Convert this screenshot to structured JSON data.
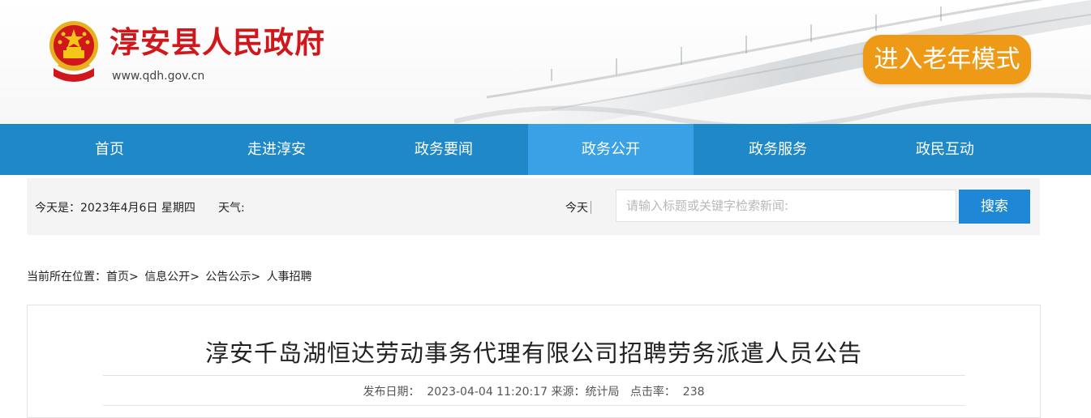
{
  "header": {
    "site_name": "淳安县人民政府",
    "site_url": "www.qdh.gov.cn",
    "elder_mode_label": "进入老年模式",
    "brand_color": "#d0171b",
    "elder_button_color": "#ef9a17"
  },
  "nav": {
    "color": "#1e88c8",
    "active_color": "#3aa1e6",
    "items": [
      {
        "label": "首页"
      },
      {
        "label": "走进淳安"
      },
      {
        "label": "政务要闻"
      },
      {
        "label": "政务公开"
      },
      {
        "label": "政务服务"
      },
      {
        "label": "政民互动"
      }
    ],
    "active_item": "政务公开"
  },
  "infobar": {
    "date_text": "今天是：2023年4月6日 星期四",
    "weather_label": "天气:",
    "today_label": "今天",
    "search_placeholder": "请输入标题或关键字检索新闻:",
    "search_button": "搜索"
  },
  "breadcrumb": {
    "prefix": "当前所在位置：",
    "items": [
      "首页",
      "信息公开",
      "公告公示",
      "人事招聘"
    ]
  },
  "article": {
    "title": "淳安千岛湖恒达劳动事务代理有限公司招聘劳务派遣人员公告",
    "publish_label": "发布日期：",
    "publish_date": "2023-04-04 11:20:17",
    "source_label": "来源：",
    "source": "统计局",
    "clicks_label": "点击率：",
    "clicks": "238"
  }
}
